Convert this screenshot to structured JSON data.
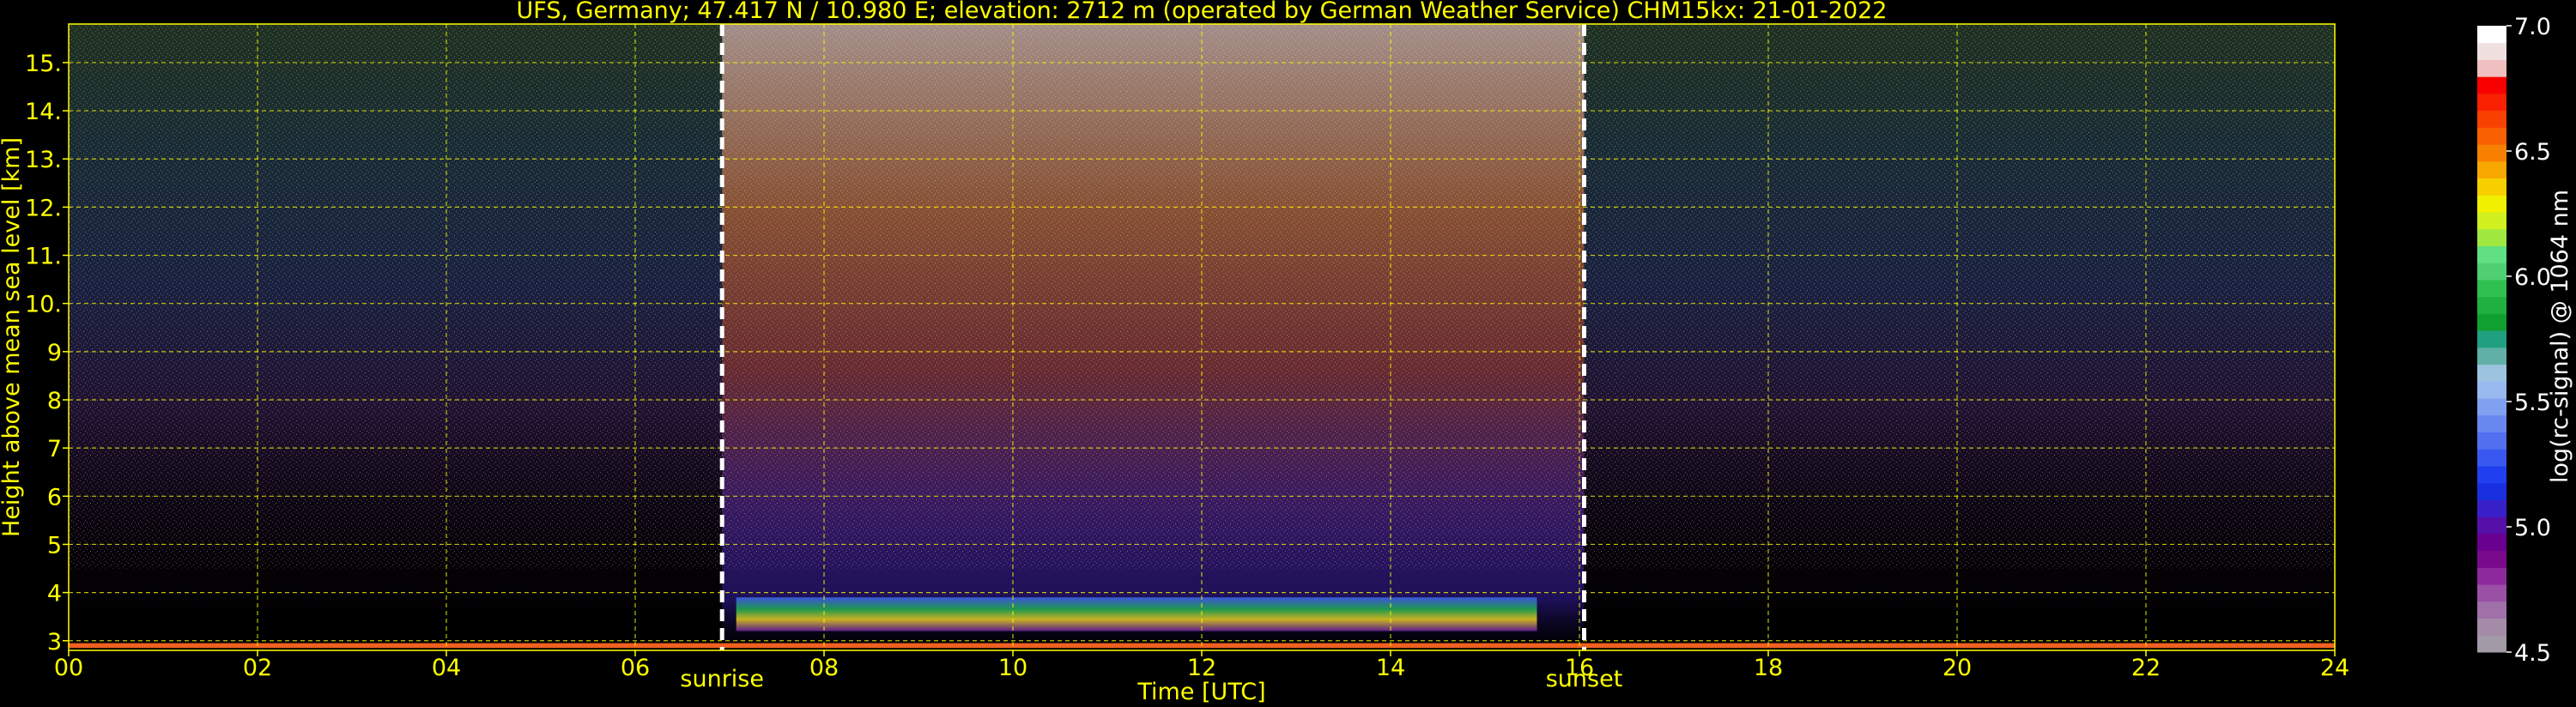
{
  "colors": {
    "background": "#000000",
    "text": "#ffff00",
    "colorbar_text": "#ffffff",
    "grid": "#ffff00",
    "marker": "#ffffff"
  },
  "chart_data": {
    "type": "heatmap",
    "title": "UFS, Germany; 47.417 N / 10.980 E; elevation: 2712 m  (operated by German Weather Service)    CHM15kx: 21-01-2022",
    "xlabel": "Time [UTC]",
    "ylabel": "Height above mean sea level [km]",
    "xlim": [
      0,
      24
    ],
    "ylim": [
      2.8,
      15.8
    ],
    "x_ticks": [
      {
        "value": 0,
        "label": "00"
      },
      {
        "value": 2,
        "label": "02"
      },
      {
        "value": 4,
        "label": "04"
      },
      {
        "value": 6,
        "label": "06"
      },
      {
        "value": 8,
        "label": "08"
      },
      {
        "value": 10,
        "label": "10"
      },
      {
        "value": 12,
        "label": "12"
      },
      {
        "value": 14,
        "label": "14"
      },
      {
        "value": 16,
        "label": "16"
      },
      {
        "value": 18,
        "label": "18"
      },
      {
        "value": 20,
        "label": "20"
      },
      {
        "value": 22,
        "label": "22"
      },
      {
        "value": 24,
        "label": "24"
      }
    ],
    "y_ticks": [
      {
        "value": 3,
        "label": "3"
      },
      {
        "value": 4,
        "label": "4"
      },
      {
        "value": 5,
        "label": "5"
      },
      {
        "value": 6,
        "label": "6"
      },
      {
        "value": 7,
        "label": "7"
      },
      {
        "value": 8,
        "label": "8"
      },
      {
        "value": 9,
        "label": "9"
      },
      {
        "value": 10,
        "label": "10."
      },
      {
        "value": 11,
        "label": "11."
      },
      {
        "value": 12,
        "label": "12."
      },
      {
        "value": 13,
        "label": "13."
      },
      {
        "value": 14,
        "label": "14."
      },
      {
        "value": 15,
        "label": "15."
      }
    ],
    "grid": true,
    "markers": [
      {
        "name": "sunrise",
        "x": 6.92,
        "label": "sunrise"
      },
      {
        "name": "sunset",
        "x": 16.05,
        "label": "sunset"
      }
    ],
    "colorbar": {
      "label": "log(rc-signal) @ 1064 nm",
      "range": [
        4.5,
        7.0
      ],
      "ticks": [
        {
          "value": 4.5,
          "label": "4.5"
        },
        {
          "value": 5.0,
          "label": "5.0"
        },
        {
          "value": 5.5,
          "label": "5.5"
        },
        {
          "value": 6.0,
          "label": "6.0"
        },
        {
          "value": 6.5,
          "label": "6.5"
        },
        {
          "value": 7.0,
          "label": "7.0"
        }
      ],
      "colors_bottom_to_top": [
        "#a39aa8",
        "#a48ca8",
        "#a070a8",
        "#9a50a4",
        "#8c2a9c",
        "#7a0a8c",
        "#6a0090",
        "#5410a8",
        "#3820c8",
        "#1830e0",
        "#2040f0",
        "#3858f0",
        "#5070f0",
        "#6888f0",
        "#80a0f0",
        "#98b8f0",
        "#9cc4e0",
        "#60b0a8",
        "#20a080",
        "#10a030",
        "#20b040",
        "#30c050",
        "#50d070",
        "#60e080",
        "#a0e840",
        "#d0f020",
        "#f0f000",
        "#f8d000",
        "#f8a800",
        "#f88000",
        "#f86000",
        "#f84000",
        "#f82000",
        "#f80000",
        "#f0c0c0",
        "#f0e0e0",
        "#ffffff"
      ]
    }
  }
}
